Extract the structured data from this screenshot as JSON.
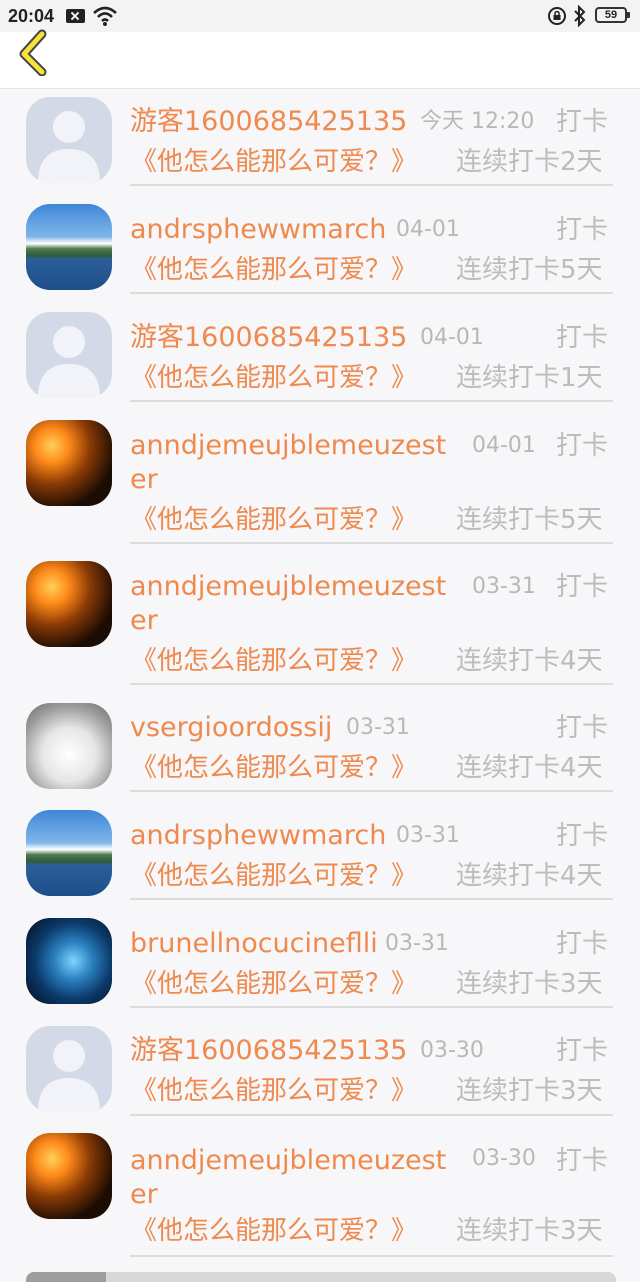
{
  "status_bar": {
    "time": "20:04",
    "battery": "59"
  },
  "header": {
    "back_icon": "chevron-left-icon"
  },
  "items": [
    {
      "name": "游客1600685425135",
      "date": "今天 12:20",
      "action": "打卡",
      "book": "《他怎么能那么可爱？》",
      "streak": "连续打卡2天",
      "avatar": "default"
    },
    {
      "name": "andrsphewwmarch",
      "date": "04-01",
      "action": "打卡",
      "book": "《他怎么能那么可爱？》",
      "streak": "连续打卡5天",
      "avatar": "lake"
    },
    {
      "name": "游客1600685425135",
      "date": "04-01",
      "action": "打卡",
      "book": "《他怎么能那么可爱？》",
      "streak": "连续打卡1天",
      "avatar": "default"
    },
    {
      "name": "anndjemeujblemeuzester",
      "date": "04-01",
      "action": "打卡",
      "book": "《他怎么能那么可爱？》",
      "streak": "连续打卡5天",
      "avatar": "fire"
    },
    {
      "name": "anndjemeujblemeuzester",
      "date": "03-31",
      "action": "打卡",
      "book": "《他怎么能那么可爱？》",
      "streak": "连续打卡4天",
      "avatar": "fire"
    },
    {
      "name": "vsergioordossij",
      "date": "03-31",
      "action": "打卡",
      "book": "《他怎么能那么可爱？》",
      "streak": "连续打卡4天",
      "avatar": "husky"
    },
    {
      "name": "andrsphewwmarch",
      "date": "03-31",
      "action": "打卡",
      "book": "《他怎么能那么可爱？》",
      "streak": "连续打卡4天",
      "avatar": "lake"
    },
    {
      "name": "brunellnocucineflli",
      "date": "03-31",
      "action": "打卡",
      "book": "《他怎么能那么可爱？》",
      "streak": "连续打卡3天",
      "avatar": "blue"
    },
    {
      "name": "游客1600685425135",
      "date": "03-30",
      "action": "打卡",
      "book": "《他怎么能那么可爱？》",
      "streak": "连续打卡3天",
      "avatar": "default"
    },
    {
      "name": "anndjemeujblemeuzester",
      "date": "03-30",
      "action": "打卡",
      "book": "《他怎么能那么可爱？》",
      "streak": "连续打卡3天",
      "avatar": "fire"
    }
  ]
}
